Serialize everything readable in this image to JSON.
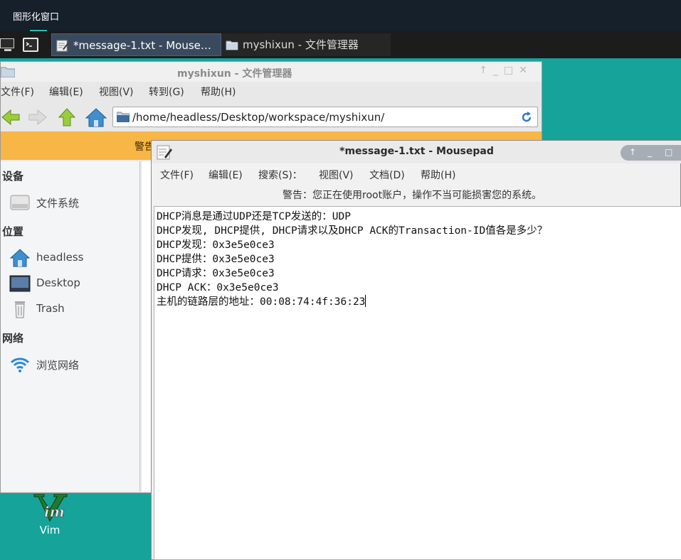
{
  "app": {
    "title": "图形化窗口"
  },
  "taskbar": {
    "items": [
      {
        "label": "*message-1.txt - Mouse…",
        "icon": "text-editor-icon"
      },
      {
        "label": "myshixun - 文件管理器",
        "icon": "folder-icon"
      }
    ]
  },
  "desktop": {
    "vim_label": "Vim"
  },
  "file_manager": {
    "title": "myshixun - 文件管理器",
    "menu": [
      "文件(F)",
      "编辑(E)",
      "视图(V)",
      "转到(G)",
      "帮助(H)"
    ],
    "address": "/home/headless/Desktop/workspace/myshixun/",
    "warning_partial": "警告",
    "sidebar": {
      "devices_heading": "设备",
      "filesystem": "文件系统",
      "places_heading": "位置",
      "home": "headless",
      "desktop": "Desktop",
      "trash": "Trash",
      "network_heading": "网络",
      "browse_network": "浏览网络"
    }
  },
  "mousepad": {
    "title": "*message-1.txt - Mousepad",
    "menu": [
      "文件(F)",
      "编辑(E)",
      "搜索(S)：",
      "视图(V)",
      "文档(D)",
      "帮助(H)"
    ],
    "warning": "警告：您正在使用root账户，操作不当可能损害您的系统。",
    "lines": [
      "DHCP消息是通过UDP还是TCP发送的：UDP",
      "DHCP发现, DHCP提供, DHCP请求以及DHCP ACK的Transaction-ID值各是多少？",
      "DHCP发现：0x3e5e0ce3",
      "DHCP提供：0x3e5e0ce3",
      "DHCP请求：0x3e5e0ce3",
      "DHCP ACK：0x3e5e0ce3",
      "主机的链路层的地址：00:08:74:4f:36:23"
    ]
  },
  "colors": {
    "desktop": "#16a39a",
    "topbar": "#16202a",
    "warning_bar": "#f8b646",
    "accent": "#2fbfa8"
  }
}
